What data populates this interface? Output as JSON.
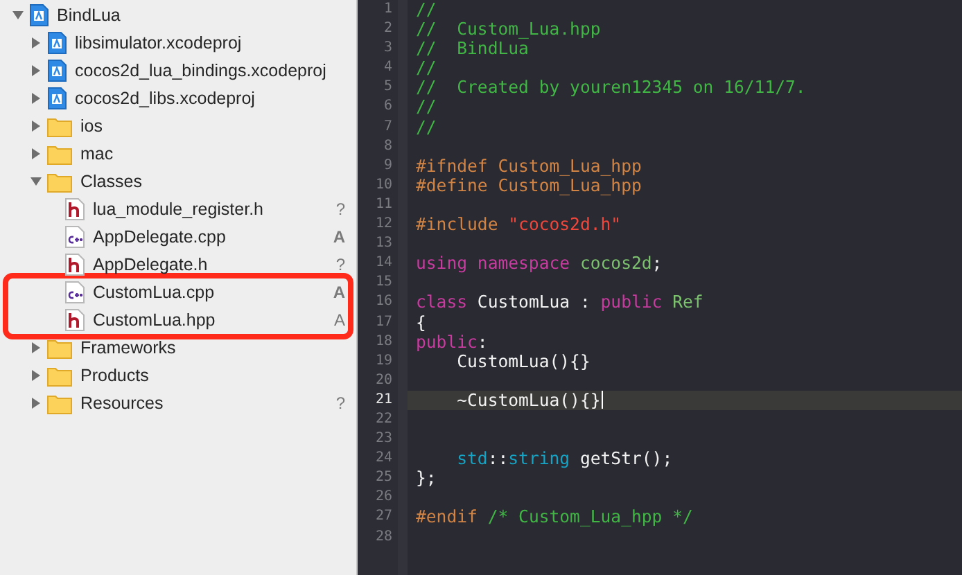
{
  "sidebar": {
    "tree": [
      {
        "label": "BindLua",
        "kind": "project",
        "expanded": true,
        "outlined": false,
        "children": [
          {
            "label": "libsimulator.xcodeproj",
            "kind": "project",
            "expanded": false,
            "outlined": false
          },
          {
            "label": "cocos2d_lua_bindings.xcodeproj",
            "kind": "project",
            "expanded": false,
            "outlined": false
          },
          {
            "label": "cocos2d_libs.xcodeproj",
            "kind": "project",
            "expanded": false,
            "outlined": false
          },
          {
            "label": "ios",
            "kind": "folder",
            "expanded": false,
            "outlined": false
          },
          {
            "label": "mac",
            "kind": "folder",
            "expanded": false,
            "outlined": false
          },
          {
            "label": "Classes",
            "kind": "folder",
            "expanded": true,
            "outlined": false,
            "children": [
              {
                "label": "lua_module_register.h",
                "kind": "header",
                "status": "?",
                "outlined": false
              },
              {
                "label": "AppDelegate.cpp",
                "kind": "source",
                "status": "A",
                "outlined": false
              },
              {
                "label": "AppDelegate.h",
                "kind": "header",
                "status": "?",
                "outlined": false
              },
              {
                "label": "CustomLua.cpp",
                "kind": "source",
                "status": "A",
                "outlined": true
              },
              {
                "label": "CustomLua.hpp",
                "kind": "header",
                "status": "A",
                "outlined": true
              }
            ]
          },
          {
            "label": "Frameworks",
            "kind": "folder",
            "expanded": false,
            "outlined": false
          },
          {
            "label": "Products",
            "kind": "folder",
            "expanded": false,
            "outlined": false
          },
          {
            "label": "Resources",
            "kind": "folder",
            "expanded": false,
            "status": "?",
            "outlined": false
          }
        ]
      }
    ]
  },
  "editor": {
    "lines": [
      {
        "number": "1",
        "current": false,
        "indented": false,
        "tokens": [
          {
            "kind": "comment",
            "text": "//"
          }
        ]
      },
      {
        "number": "2",
        "current": false,
        "indented": false,
        "tokens": [
          {
            "kind": "comment",
            "text": "//  Custom_Lua.hpp"
          }
        ]
      },
      {
        "number": "3",
        "current": false,
        "indented": false,
        "tokens": [
          {
            "kind": "comment",
            "text": "//  BindLua"
          }
        ]
      },
      {
        "number": "4",
        "current": false,
        "indented": false,
        "tokens": [
          {
            "kind": "comment",
            "text": "//"
          }
        ]
      },
      {
        "number": "5",
        "current": false,
        "indented": false,
        "tokens": [
          {
            "kind": "comment",
            "text": "//  Created by youren12345 on 16/11/7."
          }
        ]
      },
      {
        "number": "6",
        "current": false,
        "indented": false,
        "tokens": [
          {
            "kind": "comment",
            "text": "//"
          }
        ]
      },
      {
        "number": "7",
        "current": false,
        "indented": false,
        "tokens": [
          {
            "kind": "comment",
            "text": "//"
          }
        ]
      },
      {
        "number": "8",
        "current": false
      },
      {
        "number": "9",
        "current": false,
        "indented": false,
        "tokens": [
          {
            "kind": "preproc",
            "text": "#ifndef Custom_Lua_hpp"
          }
        ]
      },
      {
        "number": "10",
        "current": false,
        "indented": false,
        "tokens": [
          {
            "kind": "preproc",
            "text": "#define Custom_Lua_hpp"
          }
        ]
      },
      {
        "number": "11",
        "current": false
      },
      {
        "number": "12",
        "current": false,
        "indented": false,
        "tokens": [
          {
            "kind": "preproc",
            "text": "#include "
          },
          {
            "kind": "string",
            "text": "\"cocos2d.h\""
          }
        ]
      },
      {
        "number": "13",
        "current": false
      },
      {
        "number": "14",
        "current": false,
        "indented": false,
        "tokens": [
          {
            "kind": "keyword",
            "text": "using namespace "
          },
          {
            "kind": "type",
            "text": "cocos2d"
          },
          {
            "kind": "plain",
            "text": ";"
          }
        ]
      },
      {
        "number": "15",
        "current": false
      },
      {
        "number": "16",
        "current": false,
        "indented": false,
        "tokens": [
          {
            "kind": "keyword",
            "text": "class"
          },
          {
            "kind": "plain",
            "text": " CustomLua : "
          },
          {
            "kind": "keyword",
            "text": "public "
          },
          {
            "kind": "type",
            "text": "Ref"
          }
        ]
      },
      {
        "number": "17",
        "current": false,
        "indented": false,
        "tokens": [
          {
            "kind": "plain",
            "text": "{"
          }
        ]
      },
      {
        "number": "18",
        "current": false,
        "indented": false,
        "tokens": [
          {
            "kind": "keyword",
            "text": "public"
          },
          {
            "kind": "plain",
            "text": ":"
          }
        ]
      },
      {
        "number": "19",
        "current": false,
        "indented": true,
        "tokens": [
          {
            "kind": "plain",
            "text": "CustomLua(){}"
          }
        ]
      },
      {
        "number": "20",
        "current": false
      },
      {
        "number": "21",
        "current": true,
        "indented": true,
        "tokens": [
          {
            "kind": "plain",
            "text": "~CustomLua(){}"
          }
        ]
      },
      {
        "number": "22",
        "current": false
      },
      {
        "number": "23",
        "current": false
      },
      {
        "number": "24",
        "current": false,
        "indented": true,
        "tokens": [
          {
            "kind": "library",
            "text": "std"
          },
          {
            "kind": "plain",
            "text": "::"
          },
          {
            "kind": "library",
            "text": "string"
          },
          {
            "kind": "plain",
            "text": " getStr();"
          }
        ]
      },
      {
        "number": "25",
        "current": false,
        "indented": false,
        "tokens": [
          {
            "kind": "plain",
            "text": "};"
          }
        ]
      },
      {
        "number": "26",
        "current": false
      },
      {
        "number": "27",
        "current": false,
        "indented": false,
        "tokens": [
          {
            "kind": "preproc",
            "text": "#endif "
          },
          {
            "kind": "comment",
            "text": "/* Custom_Lua_hpp */"
          }
        ]
      },
      {
        "number": "28",
        "current": false
      }
    ]
  }
}
